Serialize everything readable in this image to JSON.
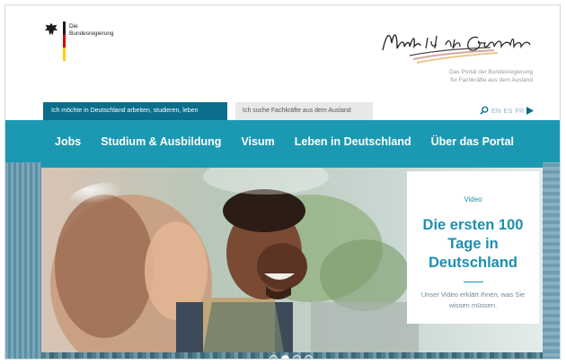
{
  "header": {
    "logo_line1": "Die",
    "logo_line2": "Bundesregierung",
    "tagline_line1": "Das Portal der Bundesregierung",
    "tagline_line2": "für Fachkräfte aus dem Ausland"
  },
  "tabs": {
    "tab1_label": "Ich möchte in Deutschland arbeiten, studieren, leben",
    "tab2_label": "Ich suche Fachkräfte aus dem Ausland"
  },
  "languages": [
    "EN",
    "ES",
    "FR"
  ],
  "nav": {
    "items": [
      "Jobs",
      "Studium & Ausbildung",
      "Visum",
      "Leben in Deutschland",
      "Über das Portal"
    ]
  },
  "hero": {
    "label": "Video",
    "title_line1": "Die ersten 100",
    "title_line2": "Tage in",
    "title_line3": "Deutschland",
    "text": "Unser Video erklärt Ihnen, was Sie wissen müssen.",
    "slide_count": 4,
    "active_slide": 2
  },
  "colors": {
    "primary": "#1c99b2",
    "tab_active": "#0a6e8c",
    "heading": "#1c8fb0"
  }
}
